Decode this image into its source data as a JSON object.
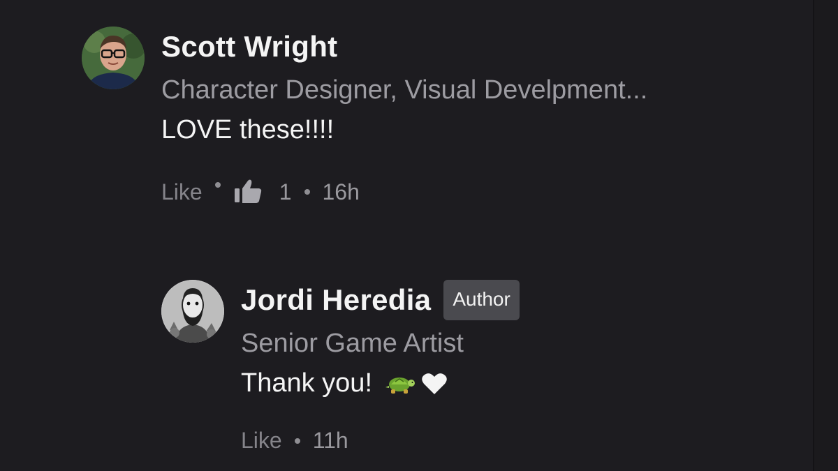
{
  "comments": [
    {
      "author": "Scott Wright",
      "headline": "Character Designer, Visual Develpment...",
      "text": "LOVE these!!!!",
      "like_label": "Like",
      "reaction_icon": "thumbs-up-icon",
      "reaction_count": "1",
      "time": "16h"
    }
  ],
  "reply": {
    "author": "Jordi Heredia",
    "badge": "Author",
    "headline": "Senior Game Artist",
    "text": "Thank you!",
    "emoji_icons": [
      "turtle-icon",
      "heart-icon"
    ],
    "like_label": "Like",
    "time": "11h"
  },
  "colors": {
    "background": "#1d1c20",
    "name": "#f4f4f4",
    "muted": "#9d9ca2",
    "badge_bg": "#4a4a4f"
  }
}
